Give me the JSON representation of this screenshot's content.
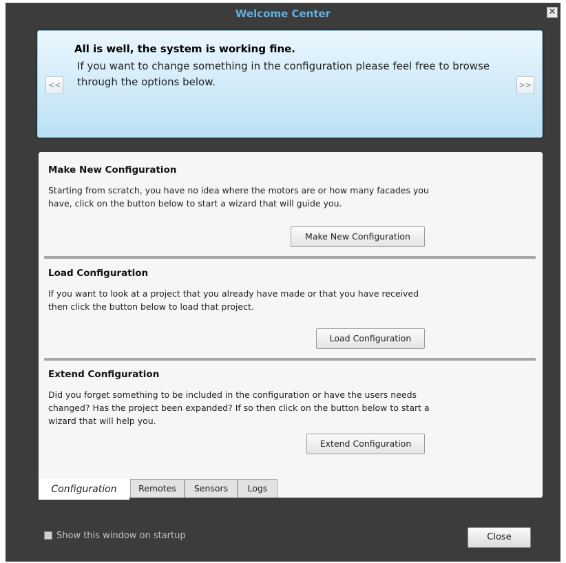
{
  "window": {
    "title": "Welcome Center",
    "close_glyph": "✕"
  },
  "banner": {
    "heading": "All is well, the system is working fine.",
    "text": "If you want to change something in the configuration please feel free to browse through the options below.",
    "prev_label": "<<",
    "next_label": ">>"
  },
  "sections": [
    {
      "title": "Make New Configuration",
      "text": "Starting from scratch, you have no idea where the motors are or how many facades you have, click on the button below to start a wizard that will guide you.",
      "button_label": "Make New Configuration"
    },
    {
      "title": "Load Configuration",
      "text": "If you want to look at a project that you already have made or that you have received then click the button below to load that project.",
      "button_label": "Load Configuration"
    },
    {
      "title": "Extend Configuration",
      "text": "Did you forget something to be included in the configuration or have the users needs changed? Has the project been expanded? If so then click on the button below to start a wizard that will help you.",
      "button_label": "Extend Configuration"
    }
  ],
  "tabs": [
    {
      "label": "Configuration",
      "active": true
    },
    {
      "label": "Remotes",
      "active": false
    },
    {
      "label": "Sensors",
      "active": false
    },
    {
      "label": "Logs",
      "active": false
    }
  ],
  "footer": {
    "startup_checkbox_label": "Show this window on startup",
    "startup_checked": false,
    "close_label": "Close"
  },
  "colors": {
    "window_bg": "#3c3c3c",
    "title": "#5fb2e6",
    "banner_bg": "#cbe8f7"
  }
}
